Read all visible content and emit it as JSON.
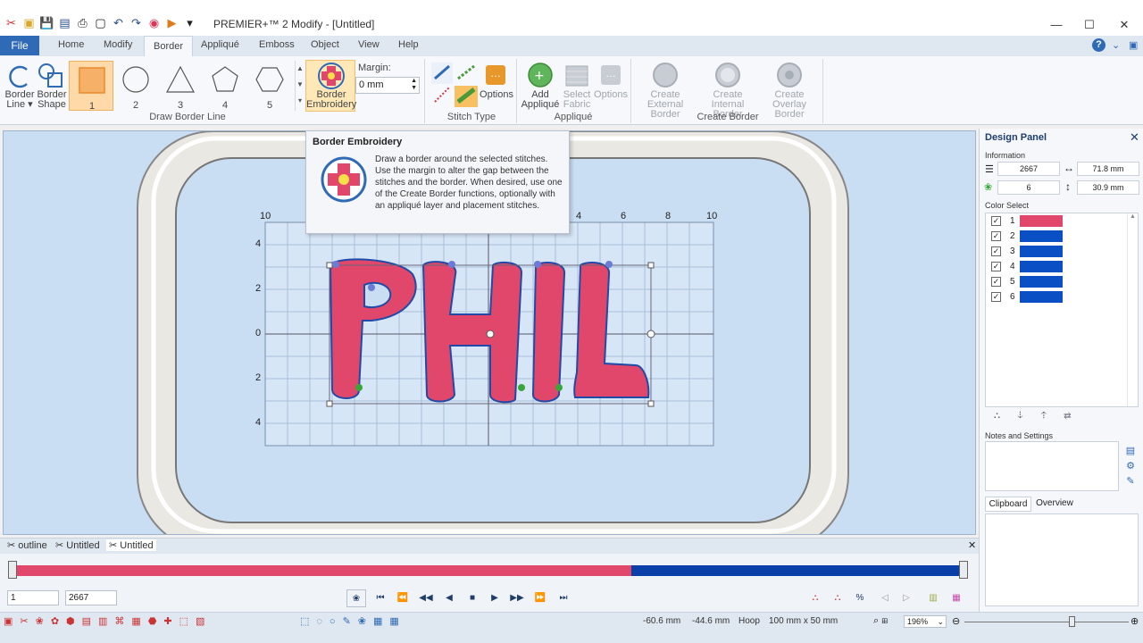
{
  "window": {
    "title": "PREMIER+™ 2 Modify - [Untitled]",
    "minimize": "—",
    "maximize": "☐",
    "close": "✕"
  },
  "menu_tabs": [
    "File",
    "Home",
    "Modify",
    "Border",
    "Appliqué",
    "Emboss",
    "Object",
    "View",
    "Help"
  ],
  "active_tab": "Border",
  "ribbon": {
    "border_line": "Border Line ▾",
    "border_shape": "Border Shape",
    "shapes": [
      "1",
      "2",
      "3",
      "4",
      "5"
    ],
    "border_embroidery": "Border Embroidery",
    "margin_label": "Margin:",
    "margin_value": "0 mm",
    "stitch_options": "Options",
    "add_applique": "Add Appliqué",
    "select_fabric": "Select Fabric",
    "applique_options": "Options",
    "create_external": "Create External Border",
    "create_internal": "Create Internal Border",
    "create_overlay": "Create Overlay Border",
    "groups": {
      "draw_border_line": "Draw Border Line",
      "stitch_type": "Stitch Type",
      "applique": "Appliqué",
      "create_border": "Create Border"
    }
  },
  "tooltip": {
    "title": "Border Embroidery",
    "body": "Draw a border around the selected stitches. Use the margin to alter the gap between the stitches and the border. When desired, use one of the Create Border functions, optionally with an appliqué layer and placement stitches."
  },
  "canvas": {
    "design_text": "PHIL",
    "x_ticks": [
      "10",
      "4",
      "6",
      "8",
      "10"
    ],
    "y_ticks": [
      "4",
      "2",
      "0",
      "2",
      "4"
    ]
  },
  "design_panel": {
    "title": "Design Panel",
    "information_label": "Information",
    "stitches": "2667",
    "width": "71.8 mm",
    "colors": "6",
    "height": "30.9 mm",
    "color_select_label": "Color Select",
    "colors_list": [
      {
        "num": "1",
        "color": "#e0476a"
      },
      {
        "num": "2",
        "color": "#0b4fc4"
      },
      {
        "num": "3",
        "color": "#0b4fc4"
      },
      {
        "num": "4",
        "color": "#0b4fc4"
      },
      {
        "num": "5",
        "color": "#0b4fc4"
      },
      {
        "num": "6",
        "color": "#0b4fc4"
      }
    ],
    "notes_label": "Notes and Settings",
    "clipboard_tab": "Clipboard",
    "overview_tab": "Overview"
  },
  "doc_tabs": [
    "outline",
    "Untitled",
    "Untitled"
  ],
  "playback": {
    "start_value": "1",
    "end_value": "2667",
    "pink_fraction": 0.65
  },
  "status": {
    "x": "-60.6 mm",
    "y": "-44.6 mm",
    "hoop_label": "Hoop",
    "hoop_size": "100 mm x 50 mm",
    "zoom": "196%"
  },
  "colors": {
    "accent": "#2f6ab6",
    "design_pink": "#e0476a",
    "design_blue": "#0b4fc4",
    "canvas": "#c9ddf3"
  }
}
